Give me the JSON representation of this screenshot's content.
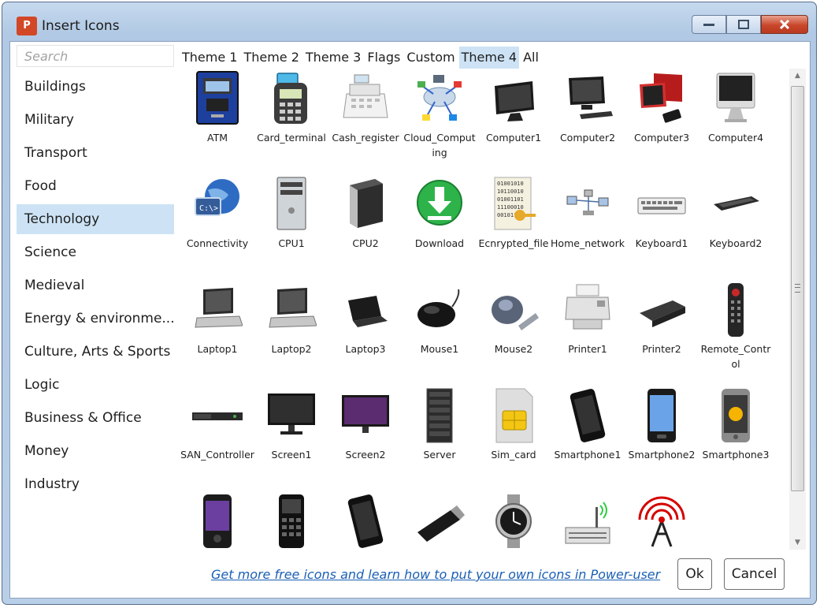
{
  "window": {
    "title": "Insert Icons",
    "app_icon_text": "P",
    "buttons": [
      "minimize",
      "maximize",
      "close"
    ]
  },
  "search": {
    "placeholder": "Search"
  },
  "categories": [
    "Buildings",
    "Military",
    "Transport",
    "Food",
    "Technology",
    "Science",
    "Medieval",
    "Energy & environme...",
    "Culture, Arts & Sports",
    "Logic",
    "Business & Office",
    "Money",
    "Industry"
  ],
  "selected_category": "Technology",
  "tabs": [
    "Theme 1",
    "Theme 2",
    "Theme 3",
    "Flags",
    "Custom",
    "Theme 4",
    "All"
  ],
  "selected_tab": "Theme 4",
  "icons": [
    {
      "label": "ATM",
      "glyph": "atm"
    },
    {
      "label": "Card_terminal",
      "glyph": "card"
    },
    {
      "label": "Cash_register",
      "glyph": "register"
    },
    {
      "label": "Cloud_Computing",
      "glyph": "cloud"
    },
    {
      "label": "Computer1",
      "glyph": "monitor"
    },
    {
      "label": "Computer2",
      "glyph": "monitor-kb"
    },
    {
      "label": "Computer3",
      "glyph": "monitor-red"
    },
    {
      "label": "Computer4",
      "glyph": "imac"
    },
    {
      "label": "Connectivity",
      "glyph": "globe"
    },
    {
      "label": "CPU1",
      "glyph": "tower"
    },
    {
      "label": "CPU2",
      "glyph": "tower-dark"
    },
    {
      "label": "Download",
      "glyph": "download"
    },
    {
      "label": "Ecnrypted_file",
      "glyph": "encrypted"
    },
    {
      "label": "Home_network",
      "glyph": "network"
    },
    {
      "label": "Keyboard1",
      "glyph": "keyboard"
    },
    {
      "label": "Keyboard2",
      "glyph": "keyboard-dark"
    },
    {
      "label": "Laptop1",
      "glyph": "laptop"
    },
    {
      "label": "Laptop2",
      "glyph": "laptop"
    },
    {
      "label": "Laptop3",
      "glyph": "laptop-dark"
    },
    {
      "label": "Mouse1",
      "glyph": "mouse"
    },
    {
      "label": "Mouse2",
      "glyph": "mouse2"
    },
    {
      "label": "Printer1",
      "glyph": "printer"
    },
    {
      "label": "Printer2",
      "glyph": "printer2"
    },
    {
      "label": "Remote_Control",
      "glyph": "remote"
    },
    {
      "label": "SAN_Controller",
      "glyph": "san"
    },
    {
      "label": "Screen1",
      "glyph": "screen"
    },
    {
      "label": "Screen2",
      "glyph": "screen-purple"
    },
    {
      "label": "Server",
      "glyph": "server"
    },
    {
      "label": "Sim_card",
      "glyph": "sim"
    },
    {
      "label": "Smartphone1",
      "glyph": "phone"
    },
    {
      "label": "Smartphone2",
      "glyph": "phone2"
    },
    {
      "label": "Smartphone3",
      "glyph": "phone3"
    },
    {
      "label": "",
      "glyph": "phone4"
    },
    {
      "label": "",
      "glyph": "feature-phone"
    },
    {
      "label": "",
      "glyph": "phone"
    },
    {
      "label": "",
      "glyph": "usb"
    },
    {
      "label": "",
      "glyph": "watch"
    },
    {
      "label": "",
      "glyph": "router"
    },
    {
      "label": "",
      "glyph": "antenna"
    }
  ],
  "footer": {
    "link": "Get more free icons and learn how to put your own icons in Power-user",
    "ok_label": "Ok",
    "cancel_label": "Cancel"
  },
  "colors": {
    "selection": "#cde3f5",
    "link": "#1a5fb4",
    "close_button": "#c8462a",
    "logo": "#d24726"
  }
}
